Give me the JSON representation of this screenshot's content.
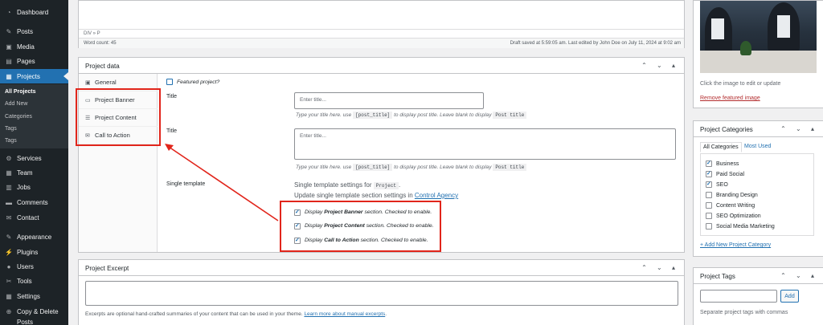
{
  "sidebar": {
    "items": [
      {
        "label": "Dashboard",
        "icon": "dashboard-icon",
        "glyph": "◔"
      },
      {
        "label": "Posts",
        "icon": "pin-icon",
        "glyph": "✎"
      },
      {
        "label": "Media",
        "icon": "media-icon",
        "glyph": "▣"
      },
      {
        "label": "Pages",
        "icon": "pages-icon",
        "glyph": "▤"
      },
      {
        "label": "Projects",
        "icon": "projects-icon",
        "glyph": "▦"
      },
      {
        "label": "Services",
        "icon": "services-icon",
        "glyph": "⚙"
      },
      {
        "label": "Team",
        "icon": "team-icon",
        "glyph": "▦"
      },
      {
        "label": "Jobs",
        "icon": "jobs-icon",
        "glyph": "▥"
      },
      {
        "label": "Comments",
        "icon": "comments-icon",
        "glyph": "▬"
      },
      {
        "label": "Contact",
        "icon": "mail-icon",
        "glyph": "✉"
      },
      {
        "label": "Appearance",
        "icon": "brush-icon",
        "glyph": "✎"
      },
      {
        "label": "Plugins",
        "icon": "plugin-icon",
        "glyph": "⚡"
      },
      {
        "label": "Users",
        "icon": "user-icon",
        "glyph": "●"
      },
      {
        "label": "Tools",
        "icon": "wrench-icon",
        "glyph": "✂"
      },
      {
        "label": "Settings",
        "icon": "settings-icon",
        "glyph": "▦"
      },
      {
        "label": "Copy & Delete",
        "icon": "copy-icon",
        "glyph": "⊕"
      },
      {
        "label": "Posts",
        "icon": "",
        "glyph": ""
      }
    ],
    "submenu": [
      "All Projects",
      "Add New",
      "Categories",
      "Tags",
      "Tags"
    ]
  },
  "editor": {
    "path": "DIV » P",
    "word_count": "Word count: 45",
    "draft_info": "Draft saved at 5:59:05 am. Last edited by John Doe on July 11, 2024 at 9:02 am"
  },
  "project_data": {
    "title": "Project data",
    "controls": "⌃ ⌄ ▴",
    "tabs": [
      {
        "label": "General",
        "glyph": "▣"
      },
      {
        "label": "Project Banner",
        "glyph": "▭"
      },
      {
        "label": "Project Content",
        "glyph": "☰"
      },
      {
        "label": "Call to Action",
        "glyph": "✉"
      }
    ],
    "featured_label": "Featured project?",
    "title_label_1": "Title",
    "title_placeholder_1": "Enter title...",
    "title_hint_prefix": "Type your title here. use",
    "title_hint_code": "[post_title]",
    "title_hint_mid": "to display post title. Leave blank to display",
    "title_hint_code2": "Post title",
    "title_label_2": "Title",
    "title_placeholder_2": "Enter title...",
    "single_template_label": "Single template",
    "single_settings_prefix": "Single template settings for",
    "single_settings_code": "Project",
    "single_settings_suffix": ".",
    "update_prefix": "Update single template section settings in",
    "update_link": "Control Agency",
    "display_prefix": "Display",
    "display_suffix": "section. Checked to enable.",
    "sections": [
      "Project Banner",
      "Project Content",
      "Call to Action"
    ]
  },
  "excerpt": {
    "title": "Project Excerpt",
    "controls": "⌃ ⌄ ▴",
    "help_prefix": "Excerpts are optional hand-crafted summaries of your content that can be used in your theme.",
    "help_link": "Learn more about manual excerpts",
    "help_suffix": "."
  },
  "featured_image": {
    "caption": "Click the image to edit or update",
    "remove_link": "Remove featured image"
  },
  "categories": {
    "title": "Project Categories",
    "controls": "⌃ ⌄ ▴",
    "tab_all": "All Categories",
    "tab_most": "Most Used",
    "items": [
      {
        "label": "Business",
        "checked": true
      },
      {
        "label": "Paid Social",
        "checked": true
      },
      {
        "label": "SEO",
        "checked": true
      },
      {
        "label": "Branding Design",
        "checked": false
      },
      {
        "label": "Content Writing",
        "checked": false
      },
      {
        "label": "SEO Optimization",
        "checked": false
      },
      {
        "label": "Social Media Marketing",
        "checked": false
      }
    ],
    "add_link": "+ Add New Project Category"
  },
  "tags": {
    "title": "Project Tags",
    "controls": "⌃ ⌄ ▴",
    "add_button": "Add",
    "help": "Separate project tags with commas"
  },
  "colors": {
    "accent": "#2271b1",
    "annotation_red": "#e1251b",
    "sidebar_bg": "#1d2327"
  }
}
